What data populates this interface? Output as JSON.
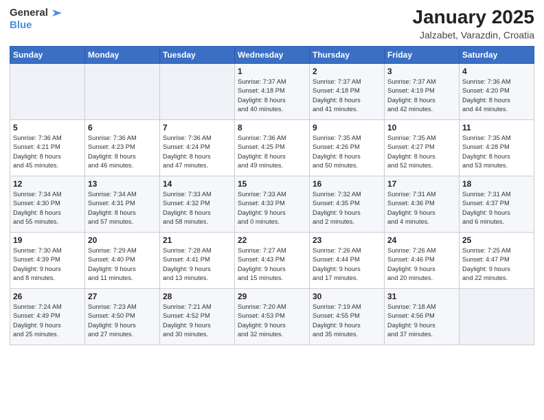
{
  "header": {
    "logo_general": "General",
    "logo_blue": "Blue",
    "month": "January 2025",
    "location": "Jalzabet, Varazdin, Croatia"
  },
  "weekdays": [
    "Sunday",
    "Monday",
    "Tuesday",
    "Wednesday",
    "Thursday",
    "Friday",
    "Saturday"
  ],
  "weeks": [
    [
      {
        "day": "",
        "info": ""
      },
      {
        "day": "",
        "info": ""
      },
      {
        "day": "",
        "info": ""
      },
      {
        "day": "1",
        "info": "Sunrise: 7:37 AM\nSunset: 4:18 PM\nDaylight: 8 hours\nand 40 minutes."
      },
      {
        "day": "2",
        "info": "Sunrise: 7:37 AM\nSunset: 4:18 PM\nDaylight: 8 hours\nand 41 minutes."
      },
      {
        "day": "3",
        "info": "Sunrise: 7:37 AM\nSunset: 4:19 PM\nDaylight: 8 hours\nand 42 minutes."
      },
      {
        "day": "4",
        "info": "Sunrise: 7:36 AM\nSunset: 4:20 PM\nDaylight: 8 hours\nand 44 minutes."
      }
    ],
    [
      {
        "day": "5",
        "info": "Sunrise: 7:36 AM\nSunset: 4:21 PM\nDaylight: 8 hours\nand 45 minutes."
      },
      {
        "day": "6",
        "info": "Sunrise: 7:36 AM\nSunset: 4:23 PM\nDaylight: 8 hours\nand 46 minutes."
      },
      {
        "day": "7",
        "info": "Sunrise: 7:36 AM\nSunset: 4:24 PM\nDaylight: 8 hours\nand 47 minutes."
      },
      {
        "day": "8",
        "info": "Sunrise: 7:36 AM\nSunset: 4:25 PM\nDaylight: 8 hours\nand 49 minutes."
      },
      {
        "day": "9",
        "info": "Sunrise: 7:35 AM\nSunset: 4:26 PM\nDaylight: 8 hours\nand 50 minutes."
      },
      {
        "day": "10",
        "info": "Sunrise: 7:35 AM\nSunset: 4:27 PM\nDaylight: 8 hours\nand 52 minutes."
      },
      {
        "day": "11",
        "info": "Sunrise: 7:35 AM\nSunset: 4:28 PM\nDaylight: 8 hours\nand 53 minutes."
      }
    ],
    [
      {
        "day": "12",
        "info": "Sunrise: 7:34 AM\nSunset: 4:30 PM\nDaylight: 8 hours\nand 55 minutes."
      },
      {
        "day": "13",
        "info": "Sunrise: 7:34 AM\nSunset: 4:31 PM\nDaylight: 8 hours\nand 57 minutes."
      },
      {
        "day": "14",
        "info": "Sunrise: 7:33 AM\nSunset: 4:32 PM\nDaylight: 8 hours\nand 58 minutes."
      },
      {
        "day": "15",
        "info": "Sunrise: 7:33 AM\nSunset: 4:33 PM\nDaylight: 9 hours\nand 0 minutes."
      },
      {
        "day": "16",
        "info": "Sunrise: 7:32 AM\nSunset: 4:35 PM\nDaylight: 9 hours\nand 2 minutes."
      },
      {
        "day": "17",
        "info": "Sunrise: 7:31 AM\nSunset: 4:36 PM\nDaylight: 9 hours\nand 4 minutes."
      },
      {
        "day": "18",
        "info": "Sunrise: 7:31 AM\nSunset: 4:37 PM\nDaylight: 9 hours\nand 6 minutes."
      }
    ],
    [
      {
        "day": "19",
        "info": "Sunrise: 7:30 AM\nSunset: 4:39 PM\nDaylight: 9 hours\nand 8 minutes."
      },
      {
        "day": "20",
        "info": "Sunrise: 7:29 AM\nSunset: 4:40 PM\nDaylight: 9 hours\nand 11 minutes."
      },
      {
        "day": "21",
        "info": "Sunrise: 7:28 AM\nSunset: 4:41 PM\nDaylight: 9 hours\nand 13 minutes."
      },
      {
        "day": "22",
        "info": "Sunrise: 7:27 AM\nSunset: 4:43 PM\nDaylight: 9 hours\nand 15 minutes."
      },
      {
        "day": "23",
        "info": "Sunrise: 7:26 AM\nSunset: 4:44 PM\nDaylight: 9 hours\nand 17 minutes."
      },
      {
        "day": "24",
        "info": "Sunrise: 7:26 AM\nSunset: 4:46 PM\nDaylight: 9 hours\nand 20 minutes."
      },
      {
        "day": "25",
        "info": "Sunrise: 7:25 AM\nSunset: 4:47 PM\nDaylight: 9 hours\nand 22 minutes."
      }
    ],
    [
      {
        "day": "26",
        "info": "Sunrise: 7:24 AM\nSunset: 4:49 PM\nDaylight: 9 hours\nand 25 minutes."
      },
      {
        "day": "27",
        "info": "Sunrise: 7:23 AM\nSunset: 4:50 PM\nDaylight: 9 hours\nand 27 minutes."
      },
      {
        "day": "28",
        "info": "Sunrise: 7:21 AM\nSunset: 4:52 PM\nDaylight: 9 hours\nand 30 minutes."
      },
      {
        "day": "29",
        "info": "Sunrise: 7:20 AM\nSunset: 4:53 PM\nDaylight: 9 hours\nand 32 minutes."
      },
      {
        "day": "30",
        "info": "Sunrise: 7:19 AM\nSunset: 4:55 PM\nDaylight: 9 hours\nand 35 minutes."
      },
      {
        "day": "31",
        "info": "Sunrise: 7:18 AM\nSunset: 4:56 PM\nDaylight: 9 hours\nand 37 minutes."
      },
      {
        "day": "",
        "info": ""
      }
    ]
  ]
}
